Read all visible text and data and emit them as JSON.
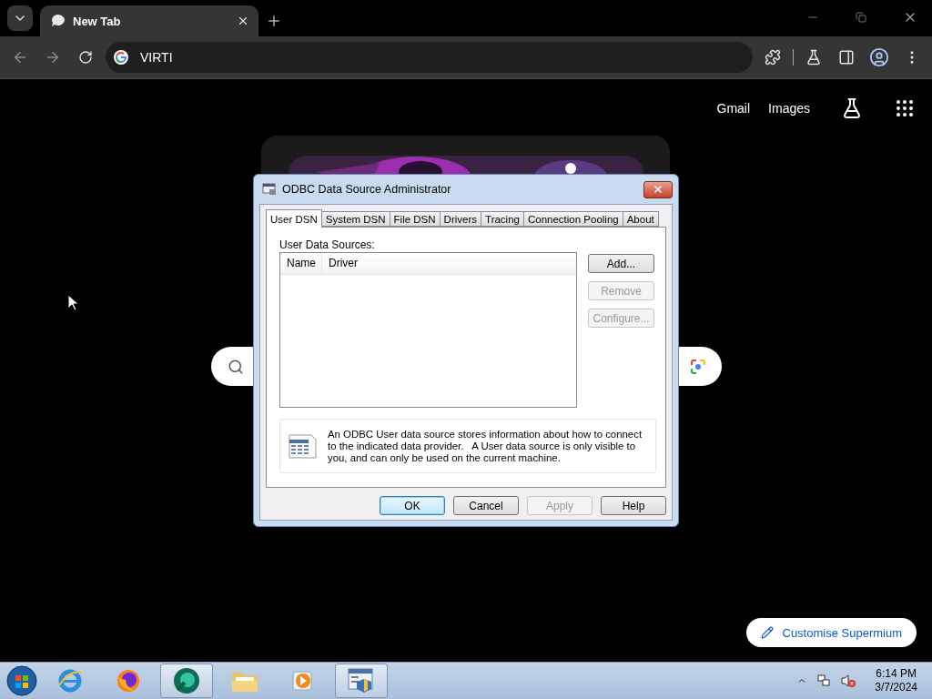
{
  "browser": {
    "tab": {
      "title": "New Tab"
    },
    "address": "VIRTI"
  },
  "page": {
    "links": [
      "Gmail",
      "Images"
    ],
    "customise_button": "Customise Supermium"
  },
  "dialog": {
    "title": "ODBC Data Source Administrator",
    "tabs": [
      {
        "label": "User DSN",
        "selected": true
      },
      {
        "label": "System DSN",
        "selected": false
      },
      {
        "label": "File DSN",
        "selected": false
      },
      {
        "label": "Drivers",
        "selected": false
      },
      {
        "label": "Tracing",
        "selected": false
      },
      {
        "label": "Connection Pooling",
        "selected": false
      },
      {
        "label": "About",
        "selected": false
      }
    ],
    "group_label": "User Data Sources:",
    "columns": [
      "Name",
      "Driver"
    ],
    "side_buttons": [
      {
        "label": "Add...",
        "disabled": false
      },
      {
        "label": "Remove",
        "disabled": true
      },
      {
        "label": "Configure...",
        "disabled": true
      }
    ],
    "info": "An ODBC User data source stores information about how to connect to the indicated data provider.   A User data source is only visible to you, and can only be used on the current machine.",
    "buttons": [
      {
        "label": "OK",
        "disabled": false,
        "default": true
      },
      {
        "label": "Cancel",
        "disabled": false,
        "default": false
      },
      {
        "label": "Apply",
        "disabled": true,
        "default": false
      },
      {
        "label": "Help",
        "disabled": false,
        "default": false
      }
    ]
  },
  "taskbar": {
    "apps": [
      {
        "kind": "ie",
        "active": false
      },
      {
        "kind": "firefox",
        "active": false
      },
      {
        "kind": "browser",
        "active": true
      },
      {
        "kind": "explorer",
        "active": false
      },
      {
        "kind": "media",
        "active": false
      },
      {
        "kind": "odbc",
        "active": true
      }
    ],
    "time": "6:14 PM",
    "date": "3/7/2024"
  }
}
